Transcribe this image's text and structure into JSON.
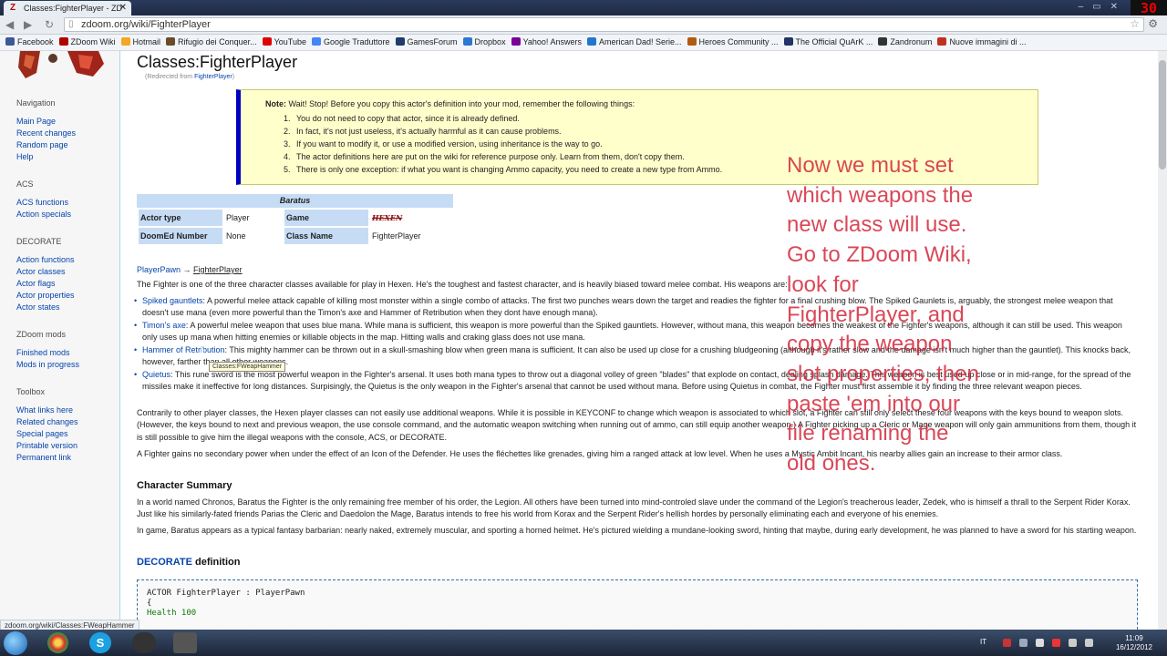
{
  "browser": {
    "tab_title": "Classes:FighterPlayer - ZD",
    "tab_close": "✕",
    "url": "zdoom.org/wiki/FighterPlayer",
    "recording": "30",
    "bookmarks": [
      {
        "label": "Facebook",
        "color": "#3b5998"
      },
      {
        "label": "ZDoom Wiki",
        "color": "#b00000"
      },
      {
        "label": "Hotmail",
        "color": "#f5a623"
      },
      {
        "label": "Rifugio dei Conquer...",
        "color": "#6b4b2a"
      },
      {
        "label": "YouTube",
        "color": "#e00000"
      },
      {
        "label": "Google Traduttore",
        "color": "#4285f4"
      },
      {
        "label": "GamesForum",
        "color": "#1d3b6b"
      },
      {
        "label": "Dropbox",
        "color": "#2a78d2"
      },
      {
        "label": "Yahoo! Answers",
        "color": "#7b0099"
      },
      {
        "label": "American Dad! Serie...",
        "color": "#2277cc"
      },
      {
        "label": "Heroes Community ...",
        "color": "#b05a10"
      },
      {
        "label": "The Official QuArK ...",
        "color": "#223366"
      },
      {
        "label": "Zandronum",
        "color": "#333333"
      },
      {
        "label": "Nuove immagini di ...",
        "color": "#c03020"
      }
    ]
  },
  "sidebar": {
    "navigation_heading": "Navigation",
    "navigation": [
      "Main Page",
      "Recent changes",
      "Random page",
      "Help"
    ],
    "acs_heading": "ACS",
    "acs": [
      "ACS functions",
      "Action specials"
    ],
    "decorate_heading": "DECORATE",
    "decorate": [
      "Action functions",
      "Actor classes",
      "Actor flags",
      "Actor properties",
      "Actor states"
    ],
    "mods_heading": "ZDoom mods",
    "mods": [
      "Finished mods",
      "Mods in progress"
    ],
    "toolbox_heading": "Toolbox",
    "toolbox": [
      "What links here",
      "Related changes",
      "Special pages",
      "Printable version",
      "Permanent link"
    ]
  },
  "article": {
    "title": "Classes:FighterPlayer",
    "redirect_prefix": "(Redirected from ",
    "redirect_link": "FighterPlayer",
    "redirect_suffix": ")",
    "note_label": "Note:",
    "note_text": " Wait! Stop! Before you copy this actor's definition into your mod, remember the following things:",
    "note_items": [
      "You do not need to copy that actor, since it is already defined.",
      "In fact, it's not just useless, it's actually harmful as it can cause problems.",
      "If you want to modify it, or use a modified version, using inheritance is the way to go.",
      "The actor definitions here are put on the wiki for reference purpose only. Learn from them, don't copy them.",
      "There is only one exception: if what you want is changing Ammo capacity, you need to create a new type from Ammo."
    ],
    "infobox": {
      "header": "Baratus",
      "actor_type_label": "Actor type",
      "actor_type_value": "Player",
      "game_label": "Game",
      "game_value": "HEXEN",
      "doomednum_label": "DoomEd Number",
      "doomednum_value": "None",
      "classname_label": "Class Name",
      "classname_value": "FighterPlayer"
    },
    "inheritance_parent": "PlayerPawn",
    "inheritance_arrow": " → ",
    "inheritance_child": "FighterPlayer",
    "intro": "The Fighter is one of the three character classes available for play in Hexen. He's the toughest and fastest character, and is heavily biased toward melee combat. His weapons are:",
    "weapons": [
      {
        "name": "Spiked gauntlets",
        "text": ": A powerful melee attack capable of killing most monster within a single combo of attacks. The first two punches wears down the target and readies the fighter for a final crushing blow. The Spiked Gaunlets is, arguably, the strongest melee weapon that doesn't use mana (even more powerful than the Timon's axe and Hammer of Retribution when they dont have enough mana)."
      },
      {
        "name": "Timon's axe",
        "text": ": A powerful melee weapon that uses blue mana. While mana is sufficient, this weapon is more powerful than the Spiked gauntlets. However, without mana, this weapon becomes the weakest of the Fighter's weapons, although it can still be used. This weapon only uses up mana when hitting enemies or killable objects in the map. Hitting walls and craking glass does not use mana."
      },
      {
        "name": "Hammer of Retribution",
        "text": ": This mighty hammer can be thrown out in a skull-smashing blow when green mana is sufficient. It can also be used up close for a crushing bludgeoning (although it's rather slow and the damage isn't much higher than the gauntlet). This knocks back, however, farther than all other weapons."
      },
      {
        "name": "Quietus",
        "text": ": This rune sword is the most powerful weapon in the Fighter's arsenal. It uses both mana types to throw out a diagonal volley of green \"blades\" that explode on contact, dealing splash damage. This weapon is best used up close or in mid-range, for the spread of the missiles make it ineffective for long distances. Surpisingly, the Quietus is the only weapon in the Fighter's arsenal that cannot be used without mana. Before using Quietus in combat, the Fighter must first assemble it by finding the three relevant weapon pieces."
      }
    ],
    "para_contrary": "Contrarily to other player classes, the Hexen player classes can not easily use additional weapons. While it is possible in KEYCONF to change which weapon is associated to which slot, a Fighter can still only select these four weapons with the keys bound to weapon slots. (However, the keys bound to next and previous weapon, the use console command, and the automatic weapon switching when running out of ammo, can still equip another weapon.) A Fighter picking up a Cleric or Mage weapon will only gain ammunitions from them, though it is still possible to give him the illegal weapons with the console, ACS, or DECORATE.",
    "para_defender": "A Fighter gains no secondary power when under the effect of an Icon of the Defender. He uses the fléchettes like grenades, giving him a ranged attack at low level. When he uses a Mystic Ambit Incant, his nearby allies gain an increase to their armor class.",
    "summary_heading": "Character Summary",
    "summary_p1": "In a world named Chronos, Baratus the Fighter is the only remaining free member of his order, the Legion. All others have been turned into mind-controled slave under the command of the Legion's treacherous leader, Zedek, who is himself a thrall to the Serpent Rider Korax. Just like his similarly-fated friends Parias the Cleric and Daedolon the Mage, Baratus intends to free his world from Korax and the Serpent Rider's hellish hordes by personally eliminating each and everyone of his enemies.",
    "summary_p2": "In game, Baratus appears as a typical fantasy barbarian: nearly naked, extremely muscular, and sporting a horned helmet. He's pictured wielding a mundane-looking sword, hinting that maybe, during early development, he was planned to have a sword for his starting weapon.",
    "decorate_link": "DECORATE",
    "decorate_suffix": " definition",
    "code_line1": "ACTOR FighterPlayer : PlayerPawn",
    "code_line2": "{",
    "code_line3": "  Health 100"
  },
  "overlay_text": [
    "Now we must set",
    "which weapons the",
    "new class will use.",
    "Go to ZDoom Wiki,",
    "look for",
    "FighterPlayer, and",
    "copy the weapon",
    "slot properties, then",
    "paste 'em into our",
    "file renaming the",
    "old ones."
  ],
  "tooltip": "Classes:FWeapHammer",
  "status_url": "zdoom.org/wiki/Classes:FWeapHammer",
  "taskbar": {
    "language": "IT",
    "time": "11:09",
    "date": "16/12/2012"
  }
}
